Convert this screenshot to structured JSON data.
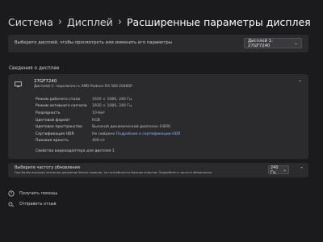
{
  "breadcrumb": {
    "items": [
      "Система",
      "Дисплей"
    ],
    "current": "Расширенные параметры дисплея",
    "separator": "›"
  },
  "display_select": {
    "label": "Выберите дисплей, чтобы просмотреть или изменить его параметры",
    "value": "Дисплей 1: 27GF7240"
  },
  "display_info": {
    "section_title": "Сведения о дисплее",
    "device_name": "27GF7240",
    "device_sub": "Дисплей 1: подключен к AMD Radeon RX 580 2048SP",
    "properties": [
      {
        "key": "Режим рабочего стола",
        "value": "1920 × 1080, 240 Гц"
      },
      {
        "key": "Режим активного сигнала",
        "value": "1920 × 1080, 240 Гц"
      },
      {
        "key": "Разрядность",
        "value": "10-бит"
      },
      {
        "key": "Цветовой формат",
        "value": "RGB"
      },
      {
        "key": "Цветовое пространство",
        "value": "Высокий динамический диапазон (HDR)"
      },
      {
        "key": "Сертификация HDR",
        "value": "Не найдено",
        "link": "Подробнее о сертификации HDR"
      },
      {
        "key": "Пиковая яркость",
        "value": "400 нт"
      }
    ],
    "adapter_link": "Свойства видеоадаптера для дисплея 1"
  },
  "refresh_rate": {
    "title": "Выберите частоту обновления",
    "description": "При более высоком значении движение более плавное, но потребляется больше энергии. Подробнее о частоте обновления",
    "value": "240 Гц"
  },
  "footer_links": {
    "help": "Получить помощь",
    "feedback": "Отправить отзыв"
  }
}
